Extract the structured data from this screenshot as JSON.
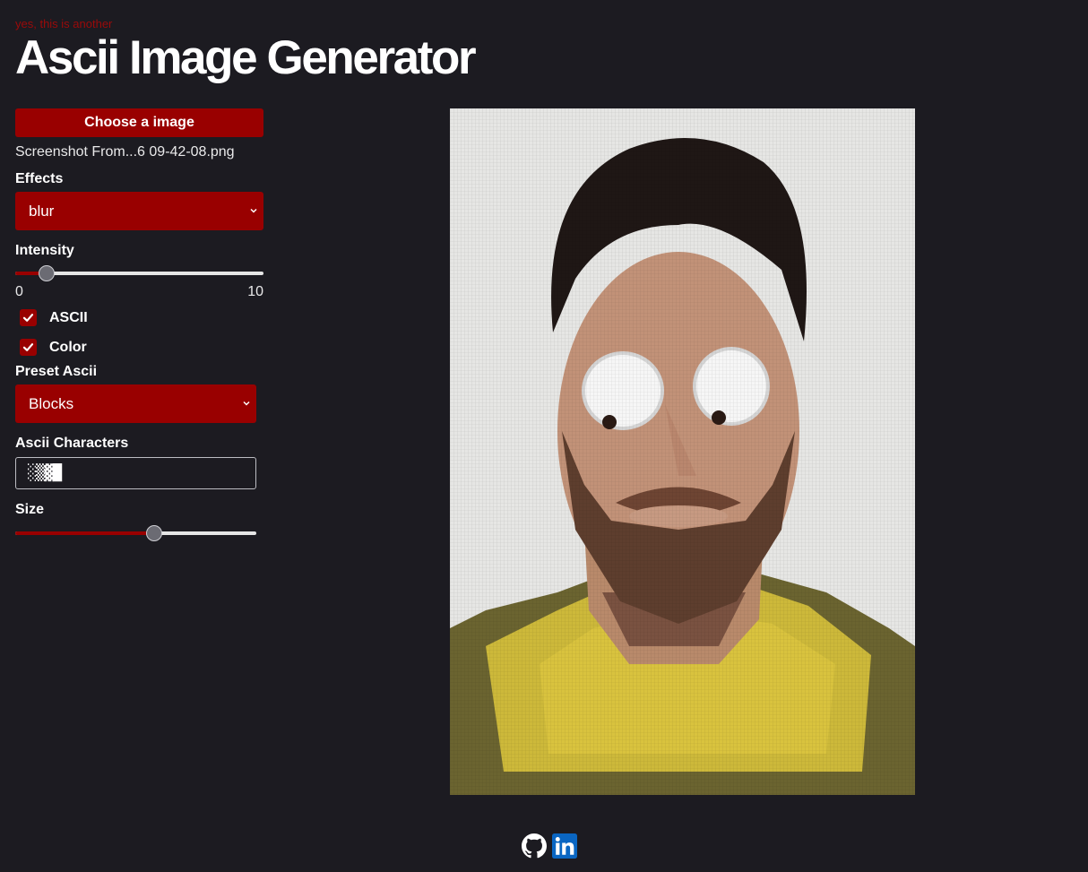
{
  "header": {
    "tagline": "yes, this is another",
    "title": "Ascii Image Generator"
  },
  "file": {
    "button_label": "Choose a image",
    "filename": "Screenshot From...6 09-42-08.png"
  },
  "effects": {
    "label": "Effects",
    "selected": "blur"
  },
  "intensity": {
    "label": "Intensity",
    "min": "0",
    "max": "10",
    "value": 1
  },
  "toggles": {
    "ascii": {
      "label": "ASCII",
      "checked": true
    },
    "color": {
      "label": "Color",
      "checked": true
    }
  },
  "preset": {
    "label": "Preset Ascii",
    "selected": "Blocks"
  },
  "characters": {
    "label": "Ascii Characters",
    "value": "░▒▓█"
  },
  "size": {
    "label": "Size",
    "fraction": 0.58
  },
  "footer": {
    "icons": [
      "github-icon",
      "linkedin-icon"
    ]
  },
  "colors": {
    "background": "#1c1b21",
    "accent": "#990000",
    "linkedin": "#0a66c2"
  }
}
